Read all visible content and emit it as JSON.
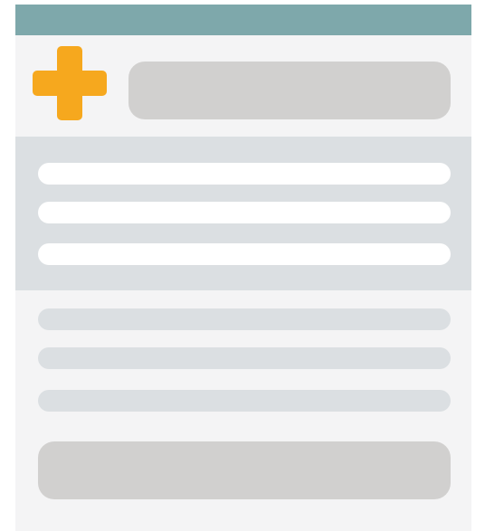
{
  "colors": {
    "header_bar": "#7ea8ab",
    "card_background": "#f4f4f5",
    "accent_plus": "#f6a81e",
    "placeholder_pill": "#d1d0cf",
    "highlight_band": "#dbdfe2",
    "line_white": "#ffffff",
    "line_grey": "#dbdfe2"
  },
  "icons": {
    "plus": "plus-icon"
  },
  "highlight_band": {
    "line_count": 3
  },
  "body_lines": {
    "line_count": 3
  }
}
